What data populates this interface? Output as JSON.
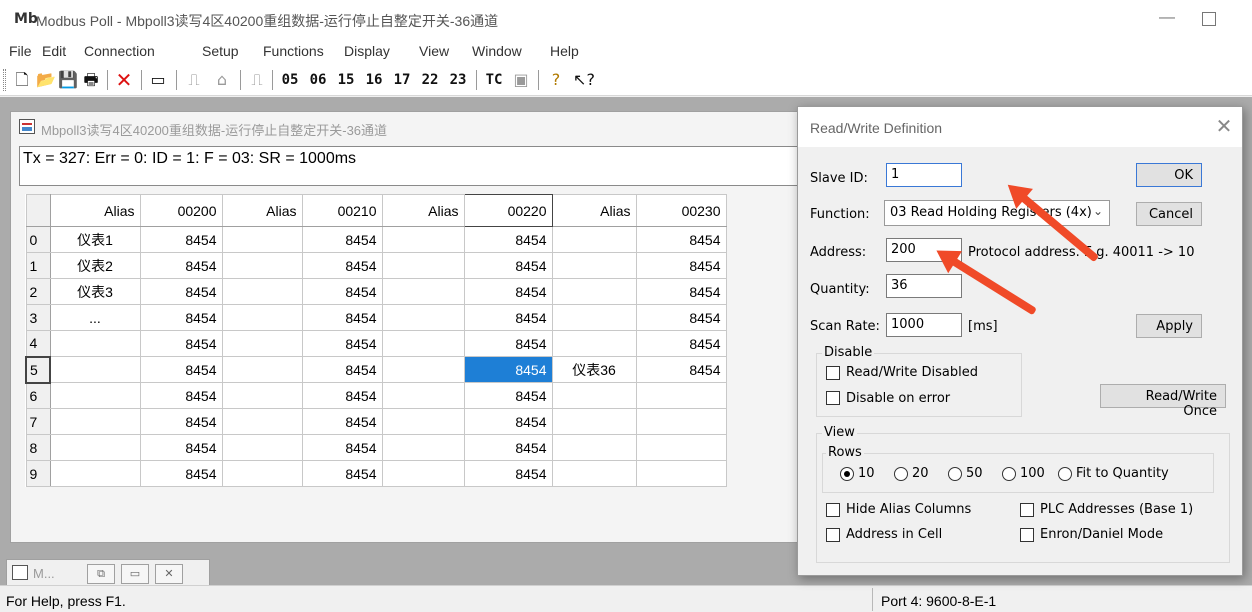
{
  "app": {
    "icon": "modbus-poll-icon",
    "title": "Modbus Poll - Mbpoll3读写4区40200重组数据-运行停止自整定开关-36通道",
    "minimize": "—"
  },
  "menu": [
    "File",
    "Edit",
    "Connection",
    "Setup",
    "Functions",
    "Display",
    "View",
    "Window",
    "Help"
  ],
  "toolbar": {
    "icons": [
      "new-icon",
      "open-icon",
      "save-icon",
      "print-icon",
      "delete-icon",
      "window-icon",
      "connect-icon",
      "disconnect-icon",
      "pulse-icon",
      "help-icon",
      "context-help-icon"
    ],
    "function_codes": [
      "05",
      "06",
      "15",
      "16",
      "17",
      "22",
      "23"
    ],
    "tc_label": "TC"
  },
  "child": {
    "title": "Mbpoll3读写4区40200重组数据-运行停止自整定开关-36通道",
    "status": "Tx = 327: Err = 0: ID = 1: F = 03: SR = 1000ms",
    "columns": [
      "Alias",
      "00200",
      "Alias",
      "00210",
      "Alias",
      "00220",
      "Alias",
      "00230"
    ],
    "rows": [
      {
        "idx": "0",
        "a1": "仪表1",
        "v1": "8454",
        "a2": "",
        "v2": "8454",
        "a3": "",
        "v3": "8454",
        "a4": "",
        "v4": "8454"
      },
      {
        "idx": "1",
        "a1": "仪表2",
        "v1": "8454",
        "a2": "",
        "v2": "8454",
        "a3": "",
        "v3": "8454",
        "a4": "",
        "v4": "8454"
      },
      {
        "idx": "2",
        "a1": "仪表3",
        "v1": "8454",
        "a2": "",
        "v2": "8454",
        "a3": "",
        "v3": "8454",
        "a4": "",
        "v4": "8454"
      },
      {
        "idx": "3",
        "a1": "...",
        "v1": "8454",
        "a2": "",
        "v2": "8454",
        "a3": "",
        "v3": "8454",
        "a4": "",
        "v4": "8454"
      },
      {
        "idx": "4",
        "a1": "",
        "v1": "8454",
        "a2": "",
        "v2": "8454",
        "a3": "",
        "v3": "8454",
        "a4": "",
        "v4": "8454"
      },
      {
        "idx": "5",
        "a1": "",
        "v1": "8454",
        "a2": "",
        "v2": "8454",
        "a3": "",
        "v3": "8454",
        "a4": "仪表36",
        "v4": "8454"
      },
      {
        "idx": "6",
        "a1": "",
        "v1": "8454",
        "a2": "",
        "v2": "8454",
        "a3": "",
        "v3": "8454",
        "a4": "",
        "v4": ""
      },
      {
        "idx": "7",
        "a1": "",
        "v1": "8454",
        "a2": "",
        "v2": "8454",
        "a3": "",
        "v3": "8454",
        "a4": "",
        "v4": ""
      },
      {
        "idx": "8",
        "a1": "",
        "v1": "8454",
        "a2": "",
        "v2": "8454",
        "a3": "",
        "v3": "8454",
        "a4": "",
        "v4": ""
      },
      {
        "idx": "9",
        "a1": "",
        "v1": "8454",
        "a2": "",
        "v2": "8454",
        "a3": "",
        "v3": "8454",
        "a4": "",
        "v4": ""
      }
    ],
    "selected_cell": {
      "row": "5",
      "column": "00220"
    },
    "tab_label": "M..."
  },
  "statusbar": {
    "help": "For Help, press F1.",
    "port": "Port 4: 9600-8-E-1"
  },
  "dialog": {
    "title": "Read/Write Definition",
    "slave_id_label": "Slave ID:",
    "slave_id": "1",
    "function_label": "Function:",
    "function_value": "03 Read Holding Registers (4x)",
    "address_label": "Address:",
    "address": "200",
    "address_hint": "Protocol address. E.g. 40011 -> 10",
    "quantity_label": "Quantity:",
    "quantity": "36",
    "scan_rate_label": "Scan Rate:",
    "scan_rate": "1000",
    "scan_unit": "[ms]",
    "ok": "OK",
    "cancel": "Cancel",
    "apply": "Apply",
    "read_write_once": "Read/Write Once",
    "disable_group": "Disable",
    "rw_disabled": "Read/Write Disabled",
    "disable_on_error": "Disable on error",
    "view_group": "View",
    "rows_group": "Rows",
    "row_options": [
      "10",
      "20",
      "50",
      "100",
      "Fit to Quantity"
    ],
    "row_selected": "10",
    "hide_alias": "Hide Alias Columns",
    "address_in_cell": "Address in Cell",
    "plc_addresses": "PLC Addresses (Base 1)",
    "enron_mode": "Enron/Daniel Mode"
  },
  "colors": {
    "selection": "#1e7fd6",
    "annotation_arrow": "#f04a28",
    "workspace": "#ababab"
  }
}
